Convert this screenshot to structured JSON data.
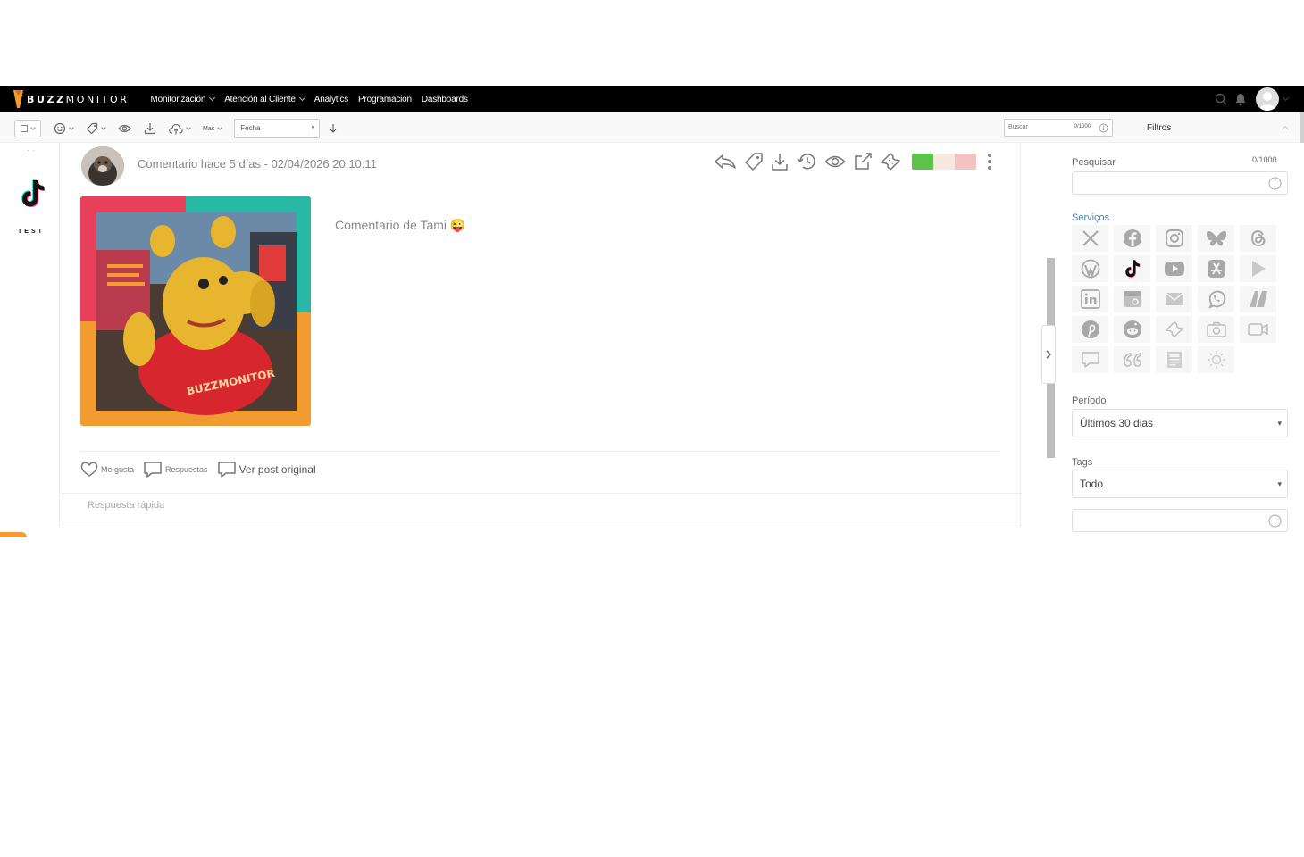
{
  "brand": {
    "bold": "BUZZ",
    "rest": "MONITOR",
    "accent": "#f29b30"
  },
  "nav": [
    {
      "label": "Monitorización",
      "caret": true
    },
    {
      "label": "Atención al Cliente",
      "caret": true
    },
    {
      "label": "Analytics",
      "caret": false
    },
    {
      "label": "Programación",
      "caret": false
    },
    {
      "label": "Dashboards",
      "caret": false
    }
  ],
  "toolbar": {
    "more_label": "Mas",
    "sort_select": "Fecha",
    "search_placeholder": "Buscar",
    "search_counter": "0/1000"
  },
  "filters_panel": {
    "title": "Filtros",
    "search_label": "Pesquisar",
    "search_counter": "0/1000",
    "services_label": "Serviços",
    "period_label": "Período",
    "period_value": "Últimos 30 dias",
    "tags_label": "Tags",
    "tags_value": "Todo",
    "services": [
      "x-icon",
      "facebook-icon",
      "instagram-icon",
      "bluesky-icon",
      "threads-icon",
      "wordpress-icon",
      "tiktok-icon",
      "youtube-icon",
      "app-store-icon",
      "google-play-icon",
      "linkedin-icon",
      "google-business-icon",
      "email-icon",
      "whatsapp-icon",
      "reclame-aqui-icon",
      "pinterest-icon",
      "reddit-icon",
      "ticket-icon",
      "camera-icon",
      "video-icon",
      "chat-icon",
      "quote-icon",
      "news-icon",
      "sun-icon"
    ]
  },
  "rail": {
    "label": "TEST"
  },
  "post": {
    "meta": "Comentario hace 5 días - 02/04/2026 20:10:11",
    "text": "Comentario de Tami 😜",
    "image_text": "BUZZMONITOR",
    "like_label": "Me gusta",
    "replies_label": "Respuestas",
    "original_label": "Ver post original",
    "quick_reply_placeholder": "Respuesta rápida",
    "sentiment_colors": {
      "positive": "#5cc24a",
      "neutral": "#f6e9df",
      "negative": "#f3c2c2"
    }
  }
}
